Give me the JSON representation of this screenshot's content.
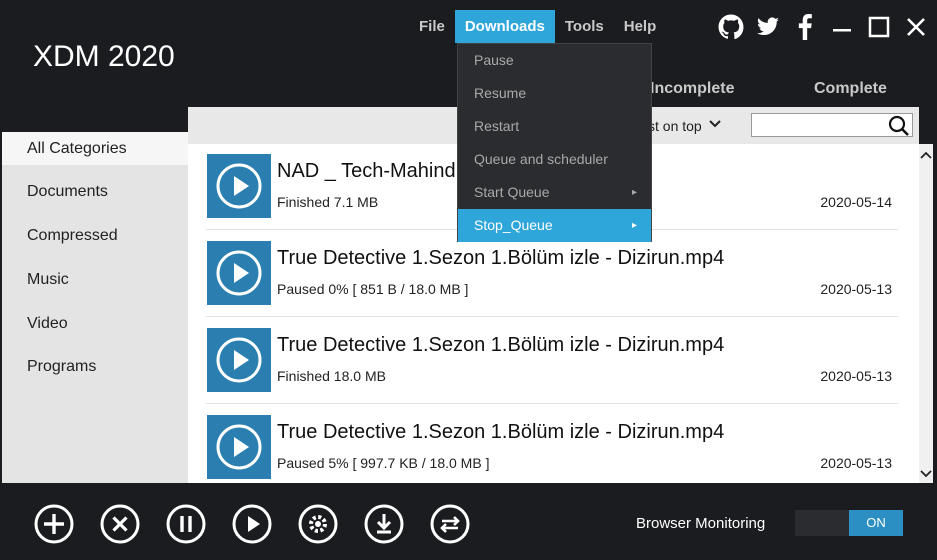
{
  "app": {
    "title": "XDM 2020"
  },
  "menu": {
    "items": [
      "File",
      "Downloads",
      "Tools",
      "Help"
    ],
    "active": "Downloads"
  },
  "window_icons": [
    "github-icon",
    "twitter-icon",
    "facebook-icon",
    "minimize-icon",
    "maximize-icon",
    "close-icon"
  ],
  "tabs": {
    "incomplete": "Incomplete",
    "complete": "Complete"
  },
  "sidebar": {
    "items": [
      "All Categories",
      "Documents",
      "Compressed",
      "Music",
      "Video",
      "Programs"
    ],
    "selected": "All Categories"
  },
  "toolbar": {
    "sort_label": "st on top"
  },
  "downloads_menu": {
    "items": [
      {
        "label": "Pause",
        "submenu": false
      },
      {
        "label": "Resume",
        "submenu": false
      },
      {
        "label": "Restart",
        "submenu": false
      },
      {
        "label": "Queue and scheduler",
        "submenu": false
      },
      {
        "label": "Start Queue",
        "submenu": true
      },
      {
        "label": "Stop_Queue",
        "submenu": true
      }
    ],
    "highlighted": "Stop_Queue",
    "arrow": "▸"
  },
  "downloads": [
    {
      "name": "NAD _ Tech-Mahindr",
      "status": "Finished 7.1 MB",
      "date": "2020-05-14"
    },
    {
      "name": "True Detective 1.Sezon 1.Bölüm  izle - Dizirun.mp4",
      "status": "Paused 0% [ 851 B / 18.0 MB ]",
      "date": "2020-05-13"
    },
    {
      "name": "True Detective 1.Sezon 1.Bölüm izle - Dizirun.mp4",
      "status": "Finished 18.0 MB",
      "date": "2020-05-13"
    },
    {
      "name": "True Detective 1.Sezon 1.Bölüm izle - Dizirun.mp4",
      "status": "Paused 5% [ 997.7 KB / 18.0 MB ]",
      "date": "2020-05-13"
    }
  ],
  "actions": [
    "add-icon",
    "delete-icon",
    "pause-icon",
    "resume-icon",
    "settings-icon",
    "download-icon",
    "convert-icon"
  ],
  "browser_monitoring": {
    "label": "Browser Monitoring",
    "state": "ON"
  },
  "colors": {
    "accent": "#2fa6da",
    "thumb": "#2b7fb0",
    "dark": "#1b1c1f"
  }
}
